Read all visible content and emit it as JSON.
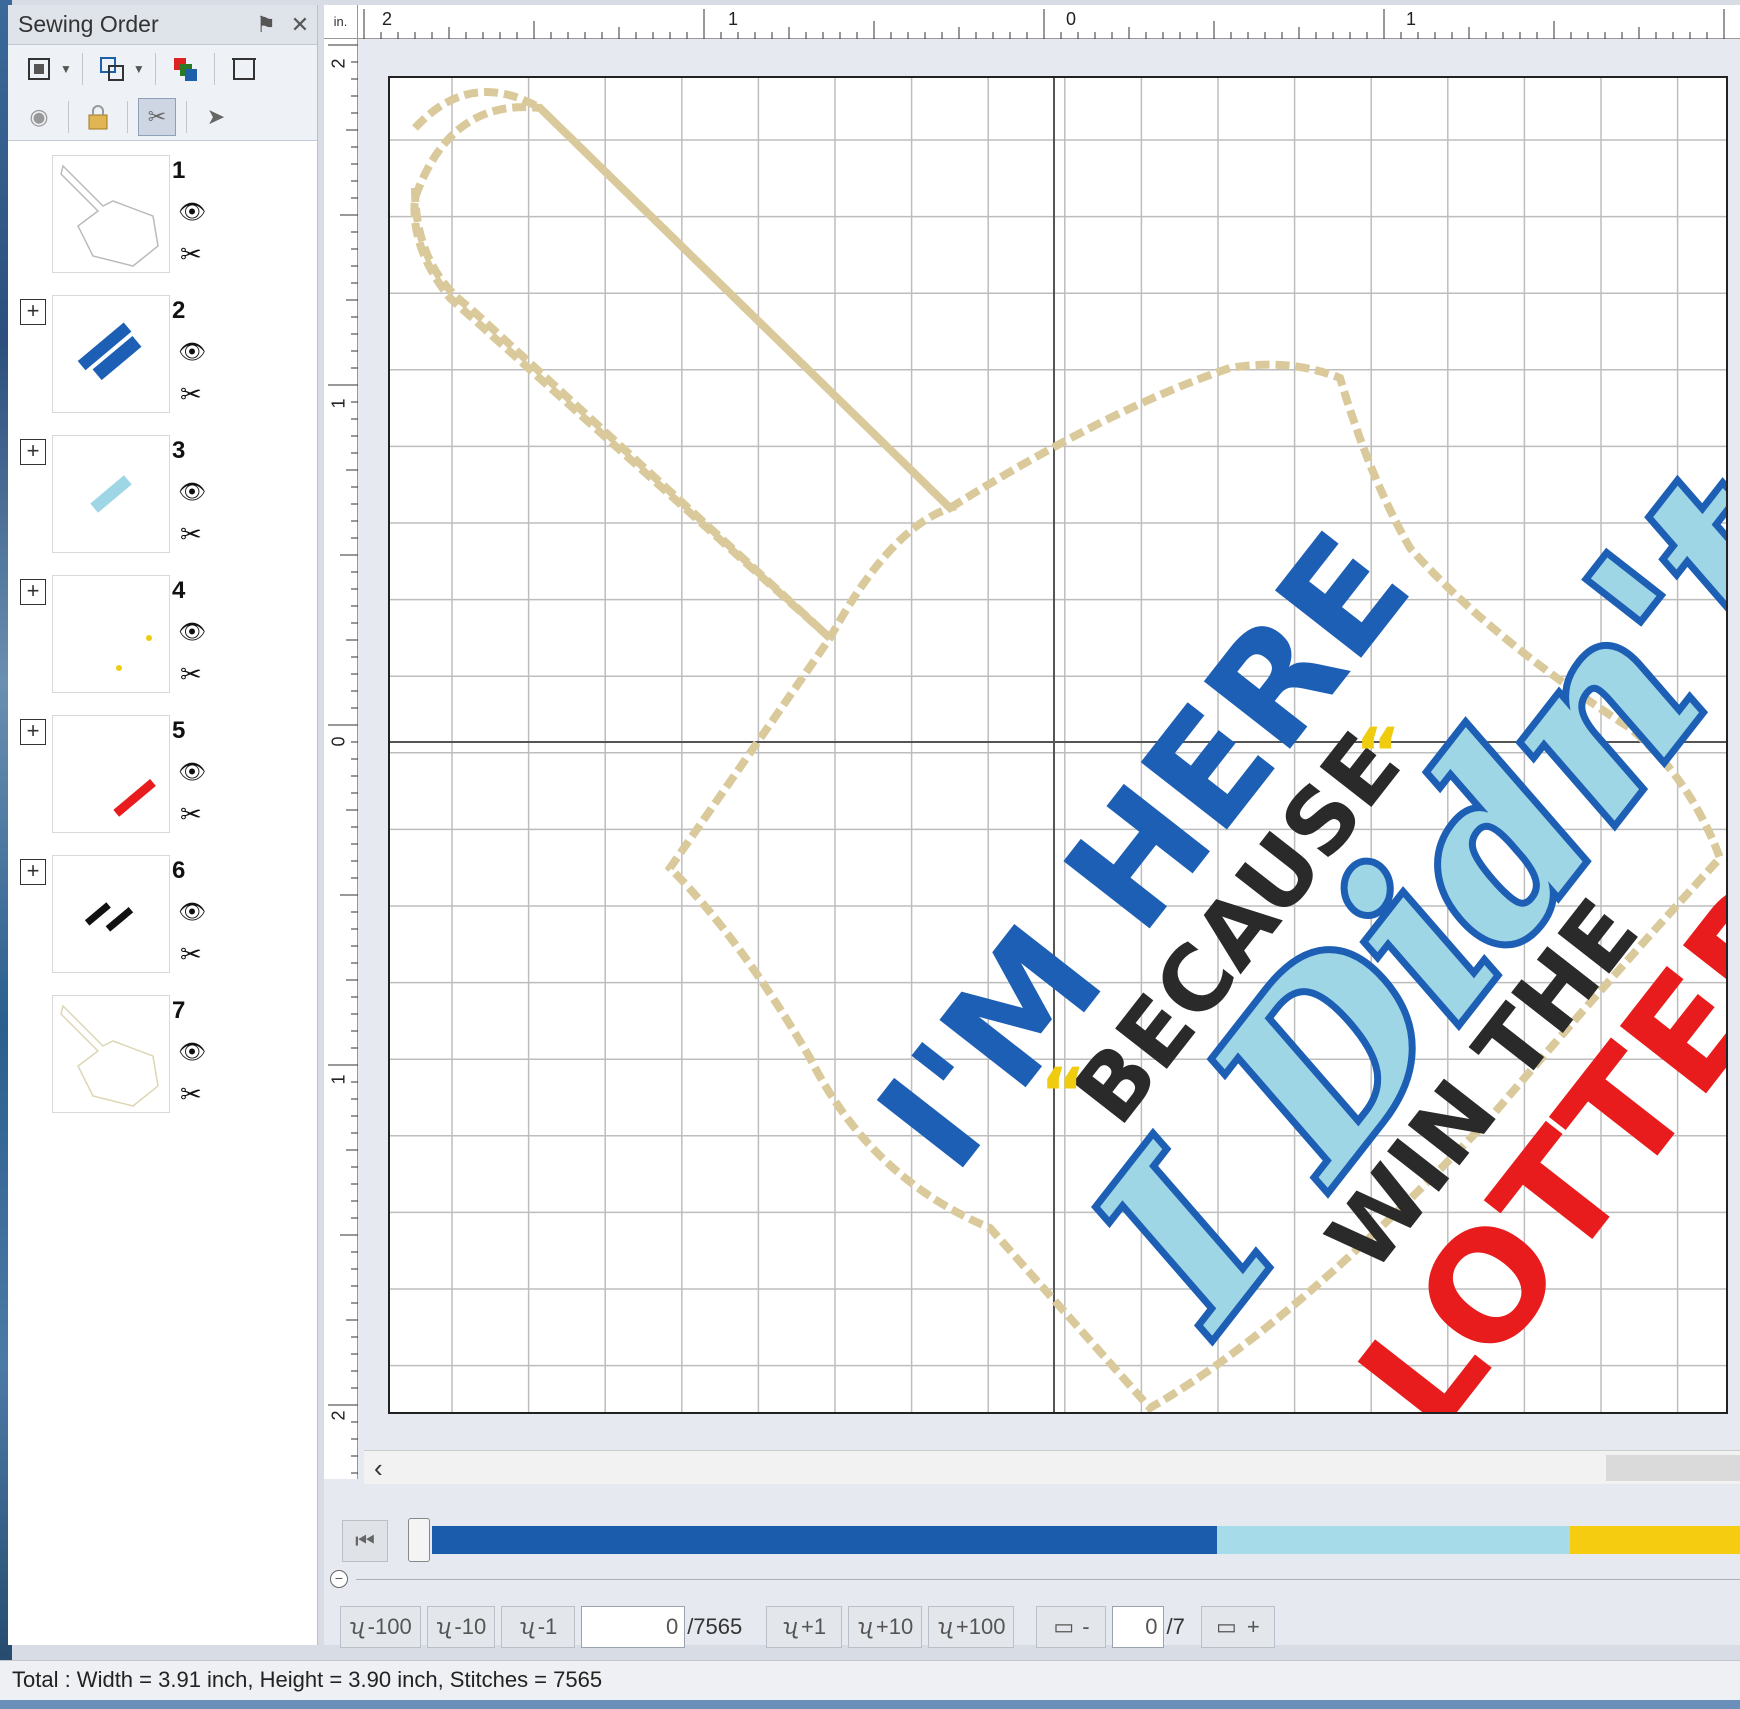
{
  "panel": {
    "title": "Sewing Order",
    "pin_glyph": "⚑",
    "close_glyph": "✕",
    "items": [
      {
        "num": "1",
        "has_expand": false
      },
      {
        "num": "2",
        "has_expand": true
      },
      {
        "num": "3",
        "has_expand": true
      },
      {
        "num": "4",
        "has_expand": true
      },
      {
        "num": "5",
        "has_expand": true
      },
      {
        "num": "6",
        "has_expand": true
      },
      {
        "num": "7",
        "has_expand": false
      }
    ],
    "expand_glyph": "+",
    "eye_glyph": "👁",
    "scissors_glyph": "✂"
  },
  "ruler": {
    "unit": "in.",
    "top_labels": [
      "2",
      "1",
      "0",
      "1"
    ],
    "left_labels": [
      "2",
      "1",
      "0",
      "1",
      "2"
    ]
  },
  "design": {
    "line1": "I'M HERE",
    "line2": "BECAUSE",
    "line3": "I Didn't",
    "line4": "WIN THE",
    "line5": "LOTTERY",
    "colors": {
      "outline": "#d8c89a",
      "blue": "#1c5fb5",
      "light_blue": "#9fd6e6",
      "black": "#2a2a2a",
      "red": "#e81c1c",
      "yellow": "#f0cc10"
    }
  },
  "progress": {
    "segments": [
      {
        "color": "#1c5cac",
        "fraction": 0.6
      },
      {
        "color": "#a6dbea",
        "fraction": 0.27
      },
      {
        "color": "#f5cc10",
        "fraction": 0.13
      }
    ]
  },
  "stitch_controls": {
    "minus100": "-100",
    "minus10": "-10",
    "minus1": "-1",
    "current_stitch": "0",
    "total_stitch": "/7565",
    "plus1": "+1",
    "plus10": "+10",
    "plus100": "+100",
    "color_minus": "-",
    "current_color": "0",
    "total_color": "/7",
    "color_plus": "+"
  },
  "status": {
    "text": "Total : Width = 3.91 inch, Height = 3.90 inch, Stitches = 7565"
  }
}
